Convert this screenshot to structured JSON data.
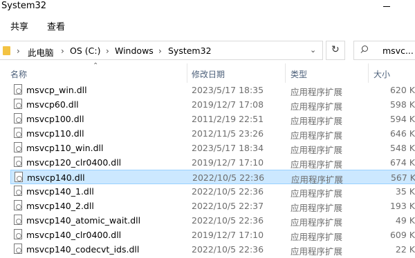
{
  "window": {
    "title": "System32"
  },
  "ribbon": {
    "tabs": [
      "共享",
      "查看"
    ]
  },
  "address": {
    "crumbs": [
      "此电脑",
      "OS (C:)",
      "Windows",
      "System32"
    ],
    "separator": "›"
  },
  "search": {
    "text": "msvc..."
  },
  "columns": {
    "name": "名称",
    "date": "修改日期",
    "type": "类型",
    "size": "大小"
  },
  "files": [
    {
      "name": "msvcp_win.dll",
      "date": "2023/5/17 18:35",
      "type": "应用程序扩展",
      "size": "620 K"
    },
    {
      "name": "msvcp60.dll",
      "date": "2019/12/7 17:08",
      "type": "应用程序扩展",
      "size": "598 K"
    },
    {
      "name": "msvcp100.dll",
      "date": "2011/2/19 22:51",
      "type": "应用程序扩展",
      "size": "594 K"
    },
    {
      "name": "msvcp110.dll",
      "date": "2012/11/5 23:26",
      "type": "应用程序扩展",
      "size": "646 K"
    },
    {
      "name": "msvcp110_win.dll",
      "date": "2023/5/17 18:34",
      "type": "应用程序扩展",
      "size": "548 K"
    },
    {
      "name": "msvcp120_clr0400.dll",
      "date": "2019/12/7 17:10",
      "type": "应用程序扩展",
      "size": "674 K"
    },
    {
      "name": "msvcp140.dll",
      "date": "2022/10/5 22:36",
      "type": "应用程序扩展",
      "size": "567 K",
      "selected": true
    },
    {
      "name": "msvcp140_1.dll",
      "date": "2022/10/5 22:36",
      "type": "应用程序扩展",
      "size": "35 K"
    },
    {
      "name": "msvcp140_2.dll",
      "date": "2022/10/5 22:37",
      "type": "应用程序扩展",
      "size": "193 K"
    },
    {
      "name": "msvcp140_atomic_wait.dll",
      "date": "2022/10/5 22:36",
      "type": "应用程序扩展",
      "size": "49 K"
    },
    {
      "name": "msvcp140_clr0400.dll",
      "date": "2019/12/7 17:10",
      "type": "应用程序扩展",
      "size": "609 K"
    },
    {
      "name": "msvcp140_codecvt_ids.dll",
      "date": "2022/10/5 22:36",
      "type": "应用程序扩展",
      "size": "22 K"
    }
  ],
  "icons": {
    "folder": "folder-icon",
    "file": "dll-file-icon",
    "refresh": "refresh-icon",
    "search": "search-icon",
    "dropdown": "chevron-down-icon"
  },
  "colors": {
    "selection": "#cce8ff",
    "selection_border": "#99d1ff",
    "header_text": "#4c607a"
  }
}
